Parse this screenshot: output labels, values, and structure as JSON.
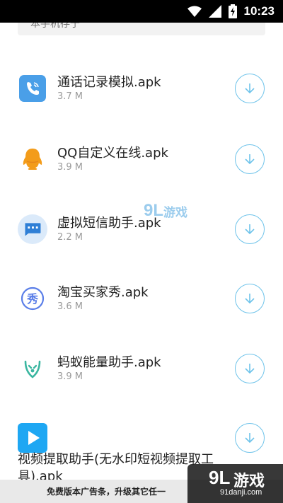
{
  "status_bar": {
    "time": "10:23"
  },
  "header": {
    "partial_text": "本手机存于"
  },
  "items": [
    {
      "name": "通话记录模拟.apk",
      "size": "3.7 M"
    },
    {
      "name": "QQ自定义在线.apk",
      "size": "3.9 M"
    },
    {
      "name": "虚拟短信助手.apk",
      "size": "2.2 M"
    },
    {
      "name": "淘宝买家秀.apk",
      "size": "3.6 M"
    },
    {
      "name": "蚂蚁能量助手.apk",
      "size": "3.9 M"
    },
    {
      "name": "视频提取助手(无水印短视频提取工具).apk"
    }
  ],
  "watermark": {
    "logo": "9L",
    "text": "游戏",
    "url": "91danji.com"
  },
  "ad_bar": {
    "text": "免费版本广告条，升级其它任一"
  },
  "colors": {
    "accent": "#6ec3ea",
    "call_icon": "#4a9fe8",
    "qq_icon": "#f39c1a",
    "sms_icon_bg": "#dbeafa",
    "sms_icon": "#2f7fd6",
    "taobao_icon": "#5a7ee8",
    "ant_icon": "#3ab6a0",
    "video_icon": "#1ea7f3"
  }
}
